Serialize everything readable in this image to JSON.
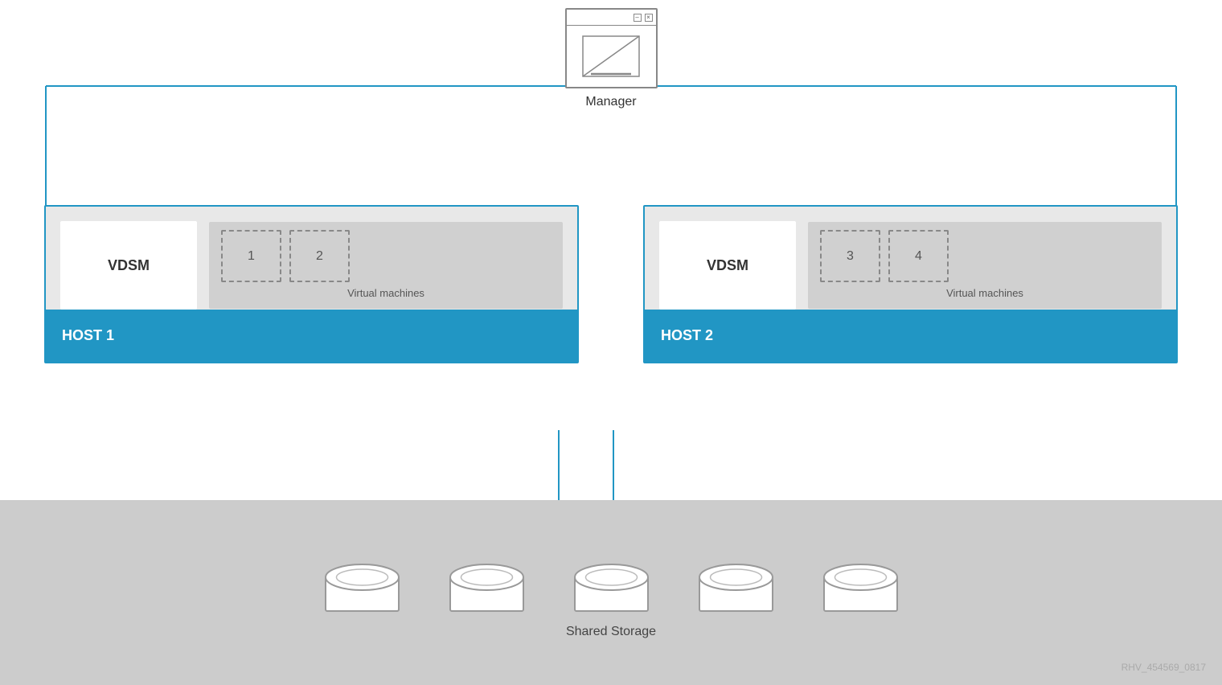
{
  "manager": {
    "label": "Manager",
    "titlebar": {
      "minimize": "–",
      "close": "×"
    }
  },
  "host1": {
    "name": "HOST 1",
    "vdsm_label": "VDSM",
    "vm_label": "Virtual machines",
    "vm1": "1",
    "vm2": "2"
  },
  "host2": {
    "name": "HOST 2",
    "vdsm_label": "VDSM",
    "vm_label": "Virtual machines",
    "vm3": "3",
    "vm4": "4"
  },
  "storage": {
    "label": "Shared Storage"
  },
  "watermark": {
    "text": "RHV_454569_0817"
  }
}
